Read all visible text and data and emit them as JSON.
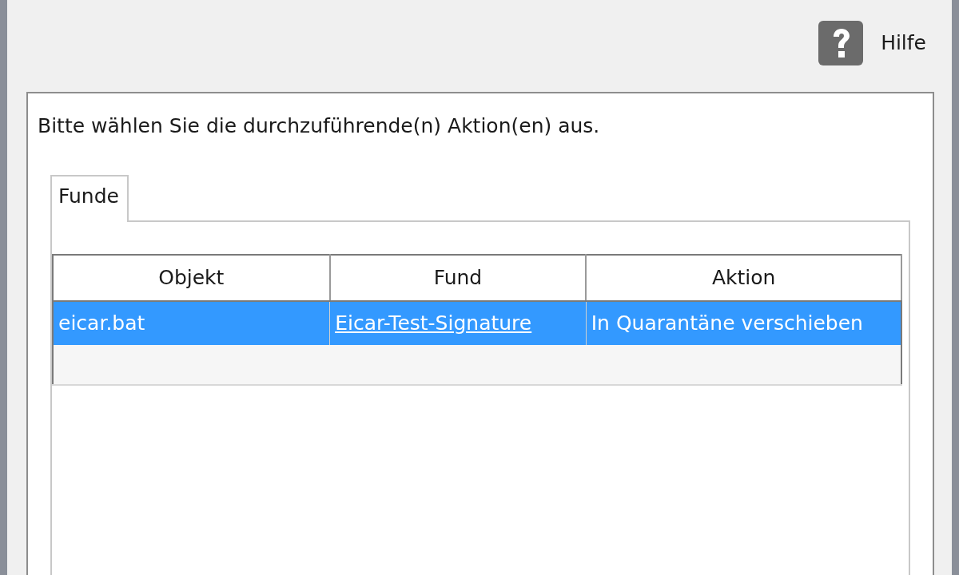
{
  "help": {
    "label": "Hilfe"
  },
  "instruction": "Bitte wählen Sie die durchzuführende(n) Aktion(en) aus.",
  "tabs": [
    {
      "label": "Funde",
      "selected": true
    }
  ],
  "table": {
    "columns": [
      "Objekt",
      "Fund",
      "Aktion"
    ],
    "rows": [
      {
        "selected": true,
        "cells": [
          {
            "kind": "text",
            "text": "eicar.bat"
          },
          {
            "kind": "link",
            "text": "Eicar-Test-Signature"
          },
          {
            "kind": "text",
            "text": "In Quarantäne verschieben"
          }
        ]
      }
    ]
  }
}
